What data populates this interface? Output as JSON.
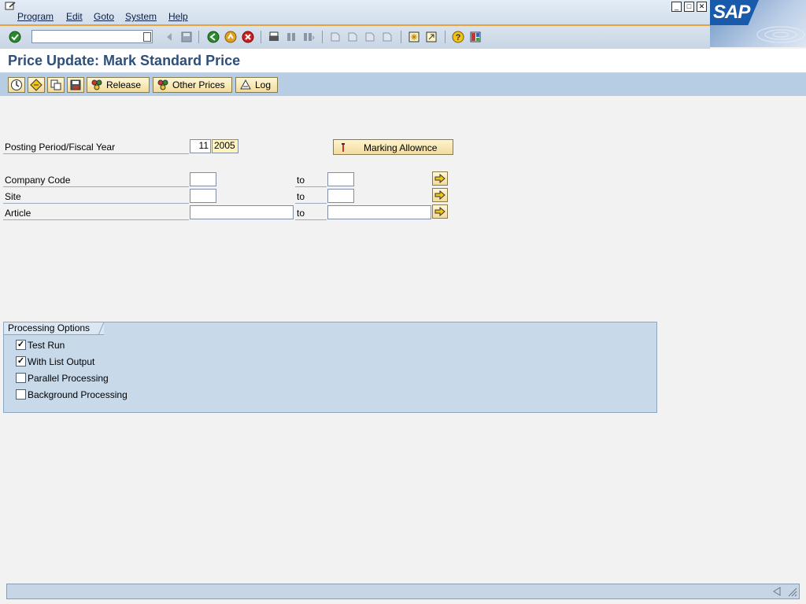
{
  "menu": {
    "items": [
      "Program",
      "Edit",
      "Goto",
      "System",
      "Help"
    ]
  },
  "window_controls": {
    "minimize": "_",
    "restore": "□",
    "close": "✕"
  },
  "logo": {
    "text": "SAP"
  },
  "command_field": {
    "value": ""
  },
  "toolbar_icons": [
    "enter-icon",
    "back-arrow-icon",
    "save-icon",
    "back-icon",
    "exit-icon",
    "cancel-icon",
    "print-icon",
    "find-icon",
    "find-next-icon",
    "first-page-icon",
    "previous-page-icon",
    "next-page-icon",
    "last-page-icon",
    "new-session-icon",
    "shortcut-icon",
    "help-icon",
    "layout-icon"
  ],
  "title": "Price Update: Mark Standard Price",
  "app_toolbar": {
    "release_label": "Release",
    "other_prices_label": "Other Prices",
    "log_label": "Log"
  },
  "selection": {
    "posting_period_label": "Posting Period/Fiscal Year",
    "posting_period_value": "11",
    "fiscal_year_value": "2005",
    "marking_button_label": "Marking Allownce",
    "company_code_label": "Company Code",
    "site_label": "Site",
    "article_label": "Article",
    "to_label": "to"
  },
  "processing_options": {
    "title": "Processing Options",
    "options": [
      {
        "label": "Test Run",
        "checked": true
      },
      {
        "label": "With List Output",
        "checked": true
      },
      {
        "label": "Parallel Processing",
        "checked": false
      },
      {
        "label": "Background Processing",
        "checked": false
      }
    ]
  },
  "checkmark": "✓",
  "colors": {
    "accent_orange": "#e8a23c",
    "title_blue": "#2e4f7c",
    "button_gold": "#f2dc9a"
  }
}
